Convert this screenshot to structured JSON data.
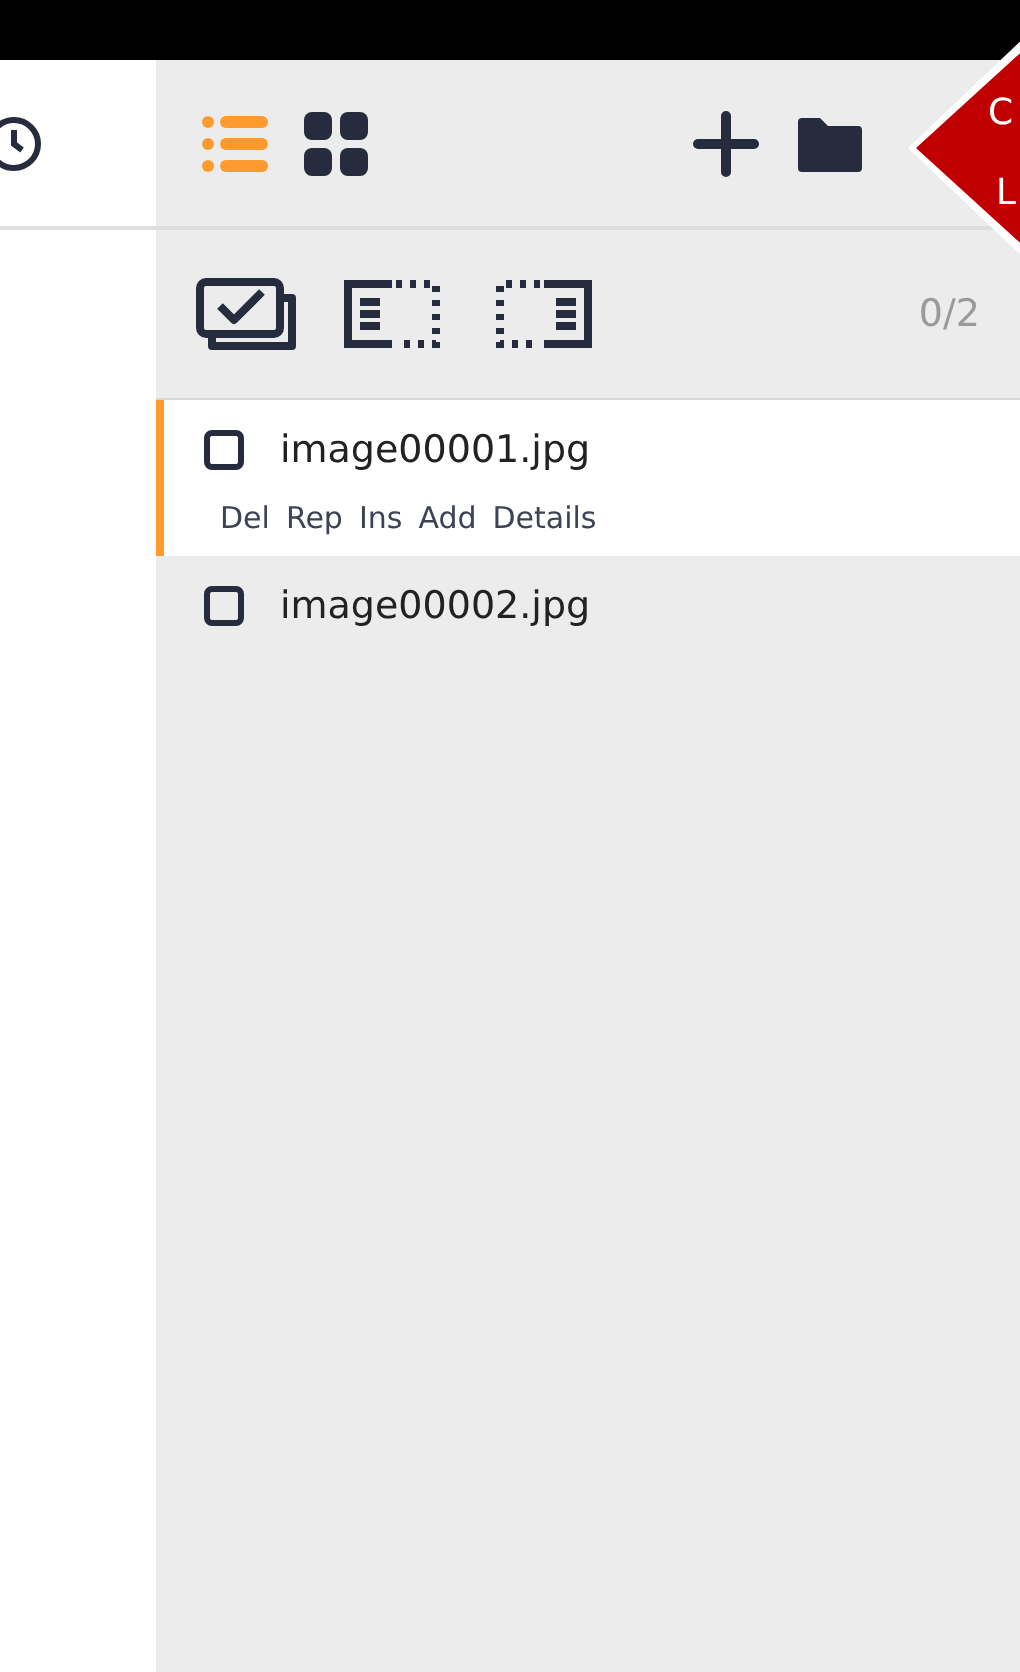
{
  "toolbar": {
    "view_modes": [
      {
        "kind": "list",
        "selected": true
      },
      {
        "kind": "grid",
        "selected": false
      }
    ]
  },
  "tooltip": {
    "lines": [
      "C",
      "L"
    ]
  },
  "selection_count": "0/2",
  "files": [
    {
      "name": "image00001.jpg",
      "checked": false,
      "selected": true,
      "actions": [
        "Del",
        "Rep",
        "Ins",
        "Add",
        "Details"
      ]
    },
    {
      "name": "image00002.jpg",
      "checked": false,
      "selected": false
    }
  ]
}
